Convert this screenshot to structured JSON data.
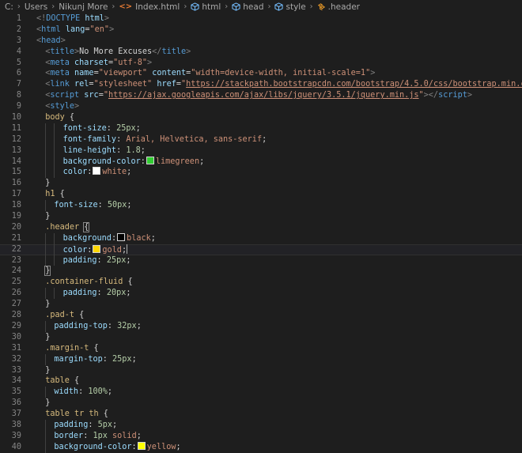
{
  "breadcrumb": {
    "path": [
      "C:",
      "Users",
      "Nikunj More"
    ],
    "file": "Index.html",
    "symbols": [
      "html",
      "head",
      "style",
      ".header"
    ]
  },
  "editor": {
    "current_line": 22,
    "lines": [
      {
        "n": 1,
        "indent": 0,
        "tokens": [
          {
            "t": "<!",
            "c": "punc"
          },
          {
            "t": "DOCTYPE",
            "c": "tag"
          },
          {
            "t": " ",
            "c": "text"
          },
          {
            "t": "html",
            "c": "attr"
          },
          {
            "t": ">",
            "c": "punc"
          }
        ]
      },
      {
        "n": 2,
        "indent": 0,
        "tokens": [
          {
            "t": "<",
            "c": "punc"
          },
          {
            "t": "html",
            "c": "tag"
          },
          {
            "t": " ",
            "c": "text"
          },
          {
            "t": "lang",
            "c": "attr"
          },
          {
            "t": "=",
            "c": "text"
          },
          {
            "t": "\"en\"",
            "c": "str"
          },
          {
            "t": ">",
            "c": "punc"
          }
        ]
      },
      {
        "n": 3,
        "indent": 0,
        "tokens": [
          {
            "t": "<",
            "c": "punc"
          },
          {
            "t": "head",
            "c": "tag"
          },
          {
            "t": ">",
            "c": "punc"
          }
        ]
      },
      {
        "n": 4,
        "indent": 1,
        "tokens": [
          {
            "t": "<",
            "c": "punc"
          },
          {
            "t": "title",
            "c": "tag"
          },
          {
            "t": ">",
            "c": "punc"
          },
          {
            "t": "No More Excuses",
            "c": "text"
          },
          {
            "t": "</",
            "c": "punc"
          },
          {
            "t": "title",
            "c": "tag"
          },
          {
            "t": ">",
            "c": "punc"
          }
        ]
      },
      {
        "n": 5,
        "indent": 1,
        "tokens": [
          {
            "t": "<",
            "c": "punc"
          },
          {
            "t": "meta",
            "c": "tag"
          },
          {
            "t": " ",
            "c": "text"
          },
          {
            "t": "charset",
            "c": "attr"
          },
          {
            "t": "=",
            "c": "text"
          },
          {
            "t": "\"utf-8\"",
            "c": "str"
          },
          {
            "t": ">",
            "c": "punc"
          }
        ]
      },
      {
        "n": 6,
        "indent": 1,
        "tokens": [
          {
            "t": "<",
            "c": "punc"
          },
          {
            "t": "meta",
            "c": "tag"
          },
          {
            "t": " ",
            "c": "text"
          },
          {
            "t": "name",
            "c": "attr"
          },
          {
            "t": "=",
            "c": "text"
          },
          {
            "t": "\"viewport\"",
            "c": "str"
          },
          {
            "t": " ",
            "c": "text"
          },
          {
            "t": "content",
            "c": "attr"
          },
          {
            "t": "=",
            "c": "text"
          },
          {
            "t": "\"width=device-width, initial-scale=1\"",
            "c": "str"
          },
          {
            "t": ">",
            "c": "punc"
          }
        ]
      },
      {
        "n": 7,
        "indent": 1,
        "tokens": [
          {
            "t": "<",
            "c": "punc"
          },
          {
            "t": "link",
            "c": "tag"
          },
          {
            "t": " ",
            "c": "text"
          },
          {
            "t": "rel",
            "c": "attr"
          },
          {
            "t": "=",
            "c": "text"
          },
          {
            "t": "\"stylesheet\"",
            "c": "str"
          },
          {
            "t": " ",
            "c": "text"
          },
          {
            "t": "href",
            "c": "attr"
          },
          {
            "t": "=",
            "c": "text"
          },
          {
            "t": "\"",
            "c": "str"
          },
          {
            "t": "https://stackpath.bootstrapcdn.com/bootstrap/4.5.0/css/bootstrap.min.css",
            "c": "url"
          },
          {
            "t": "\"",
            "c": "str"
          },
          {
            "t": ">",
            "c": "punc"
          }
        ]
      },
      {
        "n": 8,
        "indent": 1,
        "tokens": [
          {
            "t": "<",
            "c": "punc"
          },
          {
            "t": "script",
            "c": "tag"
          },
          {
            "t": " ",
            "c": "text"
          },
          {
            "t": "src",
            "c": "attr"
          },
          {
            "t": "=",
            "c": "text"
          },
          {
            "t": "\"",
            "c": "str"
          },
          {
            "t": "https://ajax.googleapis.com/ajax/libs/jquery/3.5.1/jquery.min.js",
            "c": "url"
          },
          {
            "t": "\"",
            "c": "str"
          },
          {
            "t": "></",
            "c": "punc"
          },
          {
            "t": "script",
            "c": "tag"
          },
          {
            "t": ">",
            "c": "punc"
          }
        ]
      },
      {
        "n": 9,
        "indent": 1,
        "tokens": [
          {
            "t": "<",
            "c": "punc"
          },
          {
            "t": "style",
            "c": "tag"
          },
          {
            "t": ">",
            "c": "punc"
          }
        ]
      },
      {
        "n": 10,
        "indent": 1,
        "tokens": [
          {
            "t": "body",
            "c": "sel"
          },
          {
            "t": " {",
            "c": "brace"
          }
        ]
      },
      {
        "n": 11,
        "indent": 3,
        "tokens": [
          {
            "t": "font-size",
            "c": "prop"
          },
          {
            "t": ": ",
            "c": "text"
          },
          {
            "t": "25px",
            "c": "num"
          },
          {
            "t": ";",
            "c": "text"
          }
        ]
      },
      {
        "n": 12,
        "indent": 3,
        "tokens": [
          {
            "t": "font-family",
            "c": "prop"
          },
          {
            "t": ": ",
            "c": "text"
          },
          {
            "t": "Arial, Helvetica, sans-serif",
            "c": "val"
          },
          {
            "t": ";",
            "c": "text"
          }
        ]
      },
      {
        "n": 13,
        "indent": 3,
        "tokens": [
          {
            "t": "line-height",
            "c": "prop"
          },
          {
            "t": ": ",
            "c": "text"
          },
          {
            "t": "1.8",
            "c": "num"
          },
          {
            "t": ";",
            "c": "text"
          }
        ]
      },
      {
        "n": 14,
        "indent": 3,
        "tokens": [
          {
            "t": "background-color",
            "c": "prop"
          },
          {
            "t": ":",
            "c": "text"
          },
          {
            "t": "",
            "c": "swatch",
            "color": "#32cd32"
          },
          {
            "t": "limegreen",
            "c": "val"
          },
          {
            "t": ";",
            "c": "text"
          }
        ]
      },
      {
        "n": 15,
        "indent": 3,
        "tokens": [
          {
            "t": "color",
            "c": "prop"
          },
          {
            "t": ":",
            "c": "text"
          },
          {
            "t": "",
            "c": "swatch",
            "color": "#ffffff"
          },
          {
            "t": "white",
            "c": "val"
          },
          {
            "t": ";",
            "c": "text"
          }
        ]
      },
      {
        "n": 16,
        "indent": 1,
        "tokens": [
          {
            "t": "}",
            "c": "brace"
          }
        ]
      },
      {
        "n": 17,
        "indent": 1,
        "tokens": [
          {
            "t": "h1",
            "c": "sel"
          },
          {
            "t": " {",
            "c": "brace"
          }
        ]
      },
      {
        "n": 18,
        "indent": 2,
        "tokens": [
          {
            "t": "font-size",
            "c": "prop"
          },
          {
            "t": ": ",
            "c": "text"
          },
          {
            "t": "50px",
            "c": "num"
          },
          {
            "t": ";",
            "c": "text"
          }
        ]
      },
      {
        "n": 19,
        "indent": 1,
        "tokens": [
          {
            "t": "}",
            "c": "brace"
          }
        ]
      },
      {
        "n": 20,
        "indent": 1,
        "tokens": [
          {
            "t": ".header",
            "c": "sel"
          },
          {
            "t": " ",
            "c": "text"
          },
          {
            "t": "{",
            "c": "bracematch"
          }
        ]
      },
      {
        "n": 21,
        "indent": 3,
        "tokens": [
          {
            "t": "background",
            "c": "prop"
          },
          {
            "t": ":",
            "c": "text"
          },
          {
            "t": "",
            "c": "swatch",
            "color": "#000000"
          },
          {
            "t": "black",
            "c": "val"
          },
          {
            "t": ";",
            "c": "text"
          }
        ]
      },
      {
        "n": 22,
        "indent": 3,
        "tokens": [
          {
            "t": "color",
            "c": "prop"
          },
          {
            "t": ":",
            "c": "text"
          },
          {
            "t": "",
            "c": "swatch",
            "color": "#ffd700"
          },
          {
            "t": "gold",
            "c": "val"
          },
          {
            "t": ";",
            "c": "text"
          },
          {
            "t": "",
            "c": "cursor"
          }
        ]
      },
      {
        "n": 23,
        "indent": 3,
        "tokens": [
          {
            "t": "padding",
            "c": "prop"
          },
          {
            "t": ": ",
            "c": "text"
          },
          {
            "t": "25px",
            "c": "num"
          },
          {
            "t": ";",
            "c": "text"
          }
        ]
      },
      {
        "n": 24,
        "indent": 1,
        "tokens": [
          {
            "t": "}",
            "c": "bracematch"
          }
        ]
      },
      {
        "n": 25,
        "indent": 1,
        "tokens": [
          {
            "t": ".container-fluid",
            "c": "sel"
          },
          {
            "t": " {",
            "c": "brace"
          }
        ]
      },
      {
        "n": 26,
        "indent": 3,
        "tokens": [
          {
            "t": "padding",
            "c": "prop"
          },
          {
            "t": ": ",
            "c": "text"
          },
          {
            "t": "20px",
            "c": "num"
          },
          {
            "t": ";",
            "c": "text"
          }
        ]
      },
      {
        "n": 27,
        "indent": 1,
        "tokens": [
          {
            "t": "}",
            "c": "brace"
          }
        ]
      },
      {
        "n": 28,
        "indent": 1,
        "tokens": [
          {
            "t": ".pad-t",
            "c": "sel"
          },
          {
            "t": " {",
            "c": "brace"
          }
        ]
      },
      {
        "n": 29,
        "indent": 2,
        "tokens": [
          {
            "t": "padding-top",
            "c": "prop"
          },
          {
            "t": ": ",
            "c": "text"
          },
          {
            "t": "32px",
            "c": "num"
          },
          {
            "t": ";",
            "c": "text"
          }
        ]
      },
      {
        "n": 30,
        "indent": 1,
        "tokens": [
          {
            "t": "}",
            "c": "brace"
          }
        ]
      },
      {
        "n": 31,
        "indent": 1,
        "tokens": [
          {
            "t": ".margin-t",
            "c": "sel"
          },
          {
            "t": " {",
            "c": "brace"
          }
        ]
      },
      {
        "n": 32,
        "indent": 2,
        "tokens": [
          {
            "t": "margin-top",
            "c": "prop"
          },
          {
            "t": ": ",
            "c": "text"
          },
          {
            "t": "25px",
            "c": "num"
          },
          {
            "t": ";",
            "c": "text"
          }
        ]
      },
      {
        "n": 33,
        "indent": 1,
        "tokens": [
          {
            "t": "}",
            "c": "brace"
          }
        ]
      },
      {
        "n": 34,
        "indent": 1,
        "tokens": [
          {
            "t": "table",
            "c": "sel"
          },
          {
            "t": " {",
            "c": "brace"
          }
        ]
      },
      {
        "n": 35,
        "indent": 2,
        "tokens": [
          {
            "t": "width",
            "c": "prop"
          },
          {
            "t": ": ",
            "c": "text"
          },
          {
            "t": "100%",
            "c": "num"
          },
          {
            "t": ";",
            "c": "text"
          }
        ]
      },
      {
        "n": 36,
        "indent": 1,
        "tokens": [
          {
            "t": "}",
            "c": "brace"
          }
        ]
      },
      {
        "n": 37,
        "indent": 1,
        "tokens": [
          {
            "t": "table tr th",
            "c": "sel"
          },
          {
            "t": " {",
            "c": "brace"
          }
        ]
      },
      {
        "n": 38,
        "indent": 2,
        "tokens": [
          {
            "t": "padding",
            "c": "prop"
          },
          {
            "t": ": ",
            "c": "text"
          },
          {
            "t": "5px",
            "c": "num"
          },
          {
            "t": ";",
            "c": "text"
          }
        ]
      },
      {
        "n": 39,
        "indent": 2,
        "tokens": [
          {
            "t": "border",
            "c": "prop"
          },
          {
            "t": ": ",
            "c": "text"
          },
          {
            "t": "1px",
            "c": "num"
          },
          {
            "t": " ",
            "c": "text"
          },
          {
            "t": "solid",
            "c": "val"
          },
          {
            "t": ";",
            "c": "text"
          }
        ]
      },
      {
        "n": 40,
        "indent": 2,
        "tokens": [
          {
            "t": "background-color",
            "c": "prop"
          },
          {
            "t": ":",
            "c": "text"
          },
          {
            "t": "",
            "c": "swatch",
            "color": "#ffff00"
          },
          {
            "t": "yellow",
            "c": "val"
          },
          {
            "t": ";",
            "c": "text"
          }
        ]
      }
    ]
  }
}
